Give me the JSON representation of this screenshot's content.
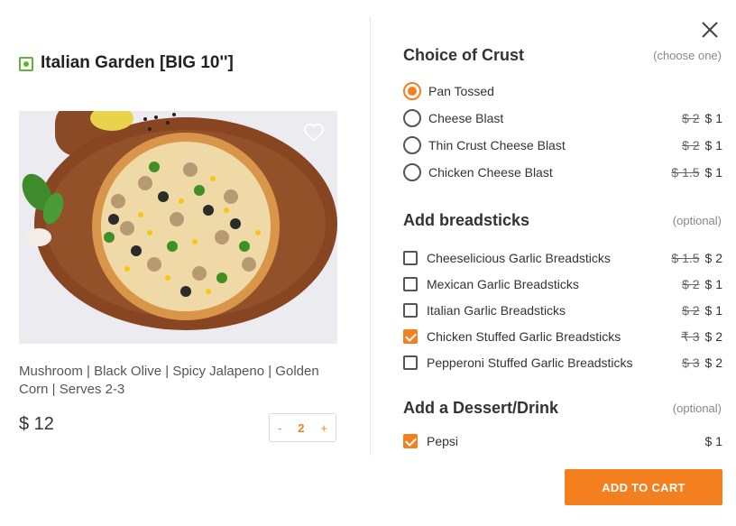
{
  "item": {
    "title": "Italian Garden [BIG 10'']",
    "description": "Mushroom | Black Olive | Spicy Jalapeno | Golden Corn | Serves 2-3",
    "price": "$ 12",
    "quantity": "2",
    "decrement": "-",
    "increment": "+",
    "veg_color": "#5fb52f"
  },
  "crust": {
    "title": "Choice of Crust",
    "hint": "(choose one)",
    "options": [
      {
        "label": "Pan Tossed",
        "old_price": "",
        "price": "",
        "selected": true
      },
      {
        "label": "Cheese Blast",
        "old_price": "$ 2",
        "price": "$ 1",
        "selected": false
      },
      {
        "label": "Thin Crust Cheese Blast",
        "old_price": "$ 2",
        "price": "$ 1",
        "selected": false
      },
      {
        "label": "Chicken Cheese Blast",
        "old_price": "$ 1.5",
        "price": "$ 1",
        "selected": false
      }
    ]
  },
  "breadsticks": {
    "title": "Add breadsticks",
    "hint": "(optional)",
    "options": [
      {
        "label": "Cheeselicious Garlic Breadsticks",
        "old_price": "$ 1.5",
        "price": "$ 2",
        "checked": false
      },
      {
        "label": "Mexican Garlic Breadsticks",
        "old_price": "$ 2",
        "price": "$ 1",
        "checked": false
      },
      {
        "label": "Italian Garlic Breadsticks",
        "old_price": "$ 2",
        "price": "$ 1",
        "checked": false
      },
      {
        "label": "Chicken Stuffed Garlic Breadsticks",
        "old_price": "₹ 3",
        "price": "$ 2",
        "checked": true
      },
      {
        "label": "Pepperoni Stuffed Garlic Breadsticks",
        "old_price": "$ 3",
        "price": "$ 2",
        "checked": false
      }
    ]
  },
  "dessert": {
    "title": "Add a Dessert/Drink",
    "hint": "(optional)",
    "options": [
      {
        "label": "Pepsi",
        "old_price": "",
        "price": "$ 1",
        "checked": true
      }
    ]
  },
  "cta": {
    "label": "ADD TO CART"
  },
  "colors": {
    "accent": "#f47f1f"
  },
  "icons": {
    "close": "close-icon",
    "favorite": "heart-icon"
  }
}
